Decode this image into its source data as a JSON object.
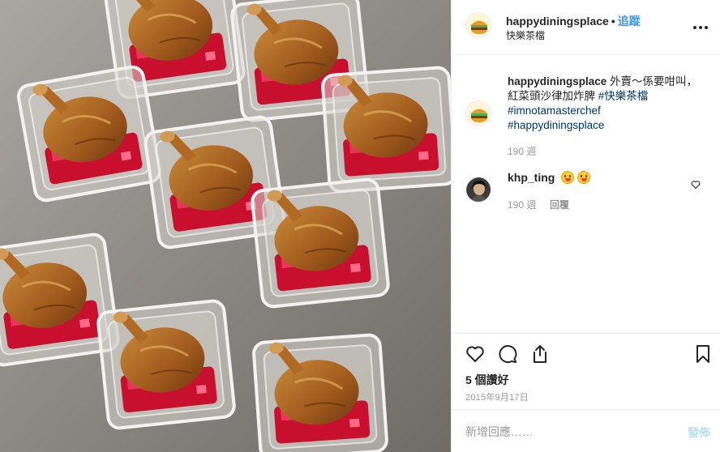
{
  "header": {
    "username": "happydiningsplace",
    "separator": "•",
    "follow_label": "追蹤",
    "location": "快樂茶檔"
  },
  "caption": {
    "username": "happydiningsplace",
    "text": "外賣～係要咁叫，紅菜頭沙律加炸脾",
    "hashtags": [
      "#快樂茶檔",
      "#imnotamasterchef",
      "#happydiningsplace"
    ],
    "time": "190 週"
  },
  "comment": {
    "username": "khp_ting",
    "time": "190 週",
    "reply_label": "回覆",
    "emoji": [
      "yum-emoji",
      "yum-emoji"
    ]
  },
  "actions": {
    "icons": [
      "heart-icon",
      "comment-icon",
      "share-icon",
      "bookmark-icon"
    ],
    "likes": "5 個讚好",
    "date": "2015年9月17日"
  },
  "add_comment": {
    "placeholder": "新增回應……",
    "post_label": "發佈"
  },
  "colors": {
    "link_blue": "#3897f0",
    "hashtag": "#003569",
    "muted": "#999999",
    "post_disabled": "#b2dffc"
  }
}
